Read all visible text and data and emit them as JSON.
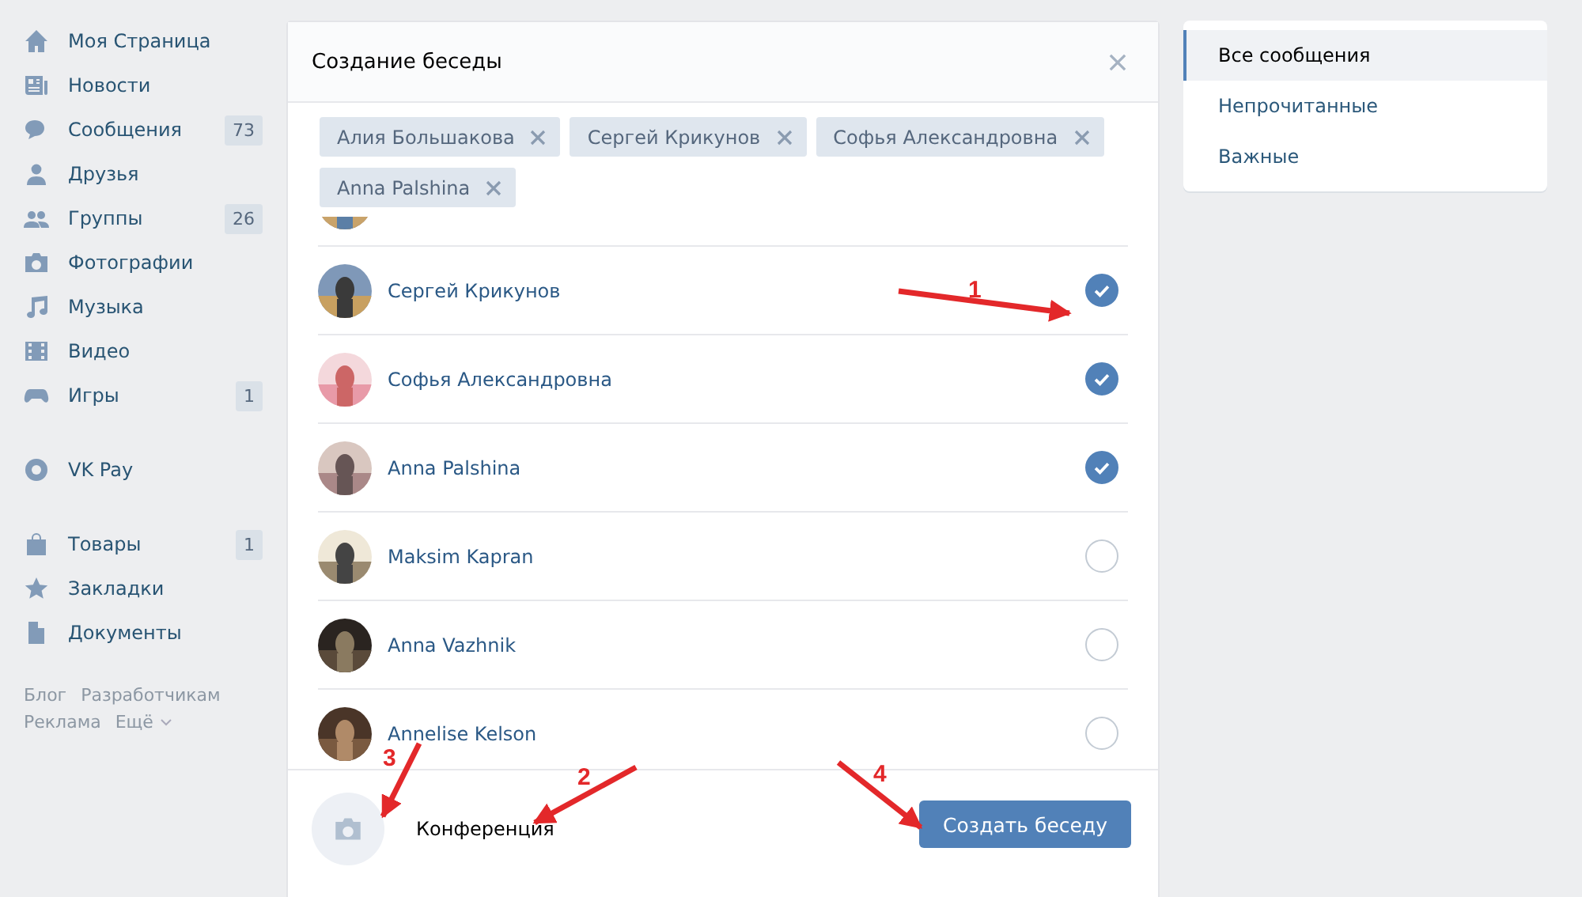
{
  "sidebar": {
    "groups": [
      [
        {
          "label": "Моя Страница"
        },
        {
          "label": "Новости"
        },
        {
          "label": "Сообщения",
          "count": "73"
        },
        {
          "label": "Друзья"
        },
        {
          "label": "Группы",
          "count": "26"
        },
        {
          "label": "Фотографии"
        },
        {
          "label": "Музыка"
        },
        {
          "label": "Видео"
        },
        {
          "label": "Игры",
          "count": "1"
        }
      ],
      [
        {
          "label": "VK Pay"
        }
      ],
      [
        {
          "label": "Товары",
          "count": "1"
        },
        {
          "label": "Закладки"
        },
        {
          "label": "Документы"
        }
      ]
    ],
    "footer_links": [
      "Блог",
      "Разработчикам",
      "Реклама",
      "Ещё"
    ]
  },
  "dialog": {
    "title": "Создание беседы",
    "chips": [
      "Алия Большакова",
      "Сергей Крикунов",
      "Софья Александровна",
      "Anna Palshina"
    ],
    "contacts": [
      {
        "kind": "partial"
      },
      {
        "name": "Сергей Крикунов",
        "checked": true
      },
      {
        "name": "Софья Александровна",
        "checked": true
      },
      {
        "name": "Anna Palshina",
        "checked": true
      },
      {
        "name": "Maksim Kapran",
        "checked": false
      },
      {
        "name": "Anna Vazhnik",
        "checked": false
      },
      {
        "name": "Annelise Kelson",
        "checked": false
      }
    ],
    "chat_name": "Конференция",
    "create_button": "Создать беседу"
  },
  "filters": [
    {
      "label": "Все сообщения",
      "selected": true
    },
    {
      "label": "Непрочитанные",
      "selected": false
    },
    {
      "label": "Важные",
      "selected": false
    }
  ],
  "annotations": [
    {
      "label": "1"
    },
    {
      "label": "2"
    },
    {
      "label": "3"
    },
    {
      "label": "4"
    }
  ]
}
